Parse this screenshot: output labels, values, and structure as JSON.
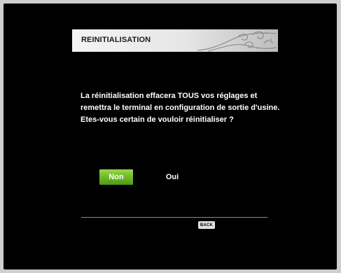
{
  "dialog": {
    "title": "REINITIALISATION",
    "message_lines": [
      "La réinitialisation effacera TOUS vos réglages et",
      "remettra le terminal en configuration de sortie d'usine.",
      "Etes-vous certain de vouloir réinitialiser ?"
    ],
    "buttons": {
      "no_label": "Non",
      "yes_label": "Oui",
      "selected": "Non"
    },
    "footer": {
      "back_key_label": "BACK"
    }
  },
  "colors": {
    "screen_background": "#000000",
    "title_bar": "#e6e6e6",
    "selected_button": "#6fb82a",
    "text": "#ffffff"
  },
  "icons": {
    "title_decoration": "swirl-ornament-icon"
  }
}
